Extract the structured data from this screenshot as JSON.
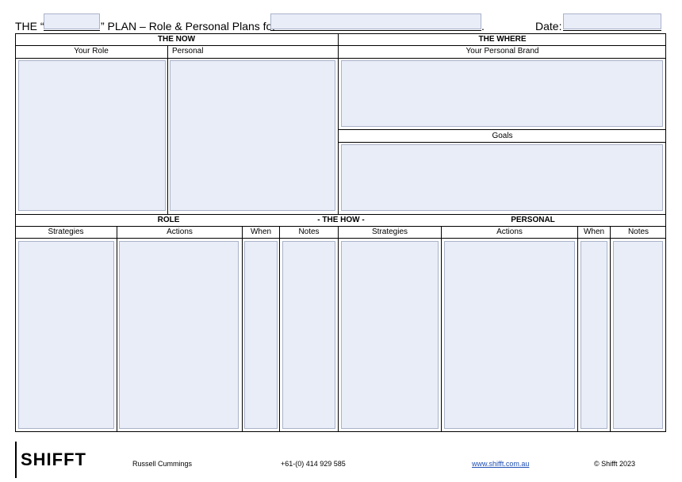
{
  "title": {
    "prefix": "THE “",
    "suffix": "” PLAN – Role & Personal Plans for",
    "period": ".",
    "date_label": "Date:"
  },
  "sections": {
    "the_now": "THE NOW",
    "the_where": "THE WHERE",
    "your_role": "Your Role",
    "personal": "Personal",
    "your_personal_brand": "Your Personal Brand",
    "goals": "Goals",
    "role": "ROLE",
    "the_how": "- THE HOW -",
    "personal_caps": "PERSONAL"
  },
  "how_columns": {
    "role": [
      "Strategies",
      "Actions",
      "When",
      "Notes"
    ],
    "personal": [
      "Strategies",
      "Actions",
      "When",
      "Notes"
    ]
  },
  "footer": {
    "logo": "SHIFFT",
    "name": "Russell Cummings",
    "phone": "+61-(0) 414 929 585",
    "website": "www.shifft.com.au",
    "copyright": "© Shifft 2023"
  },
  "colors": {
    "field_fill": "#e9edf8",
    "field_border": "#a9b2c8",
    "link": "#1f4fb3"
  }
}
